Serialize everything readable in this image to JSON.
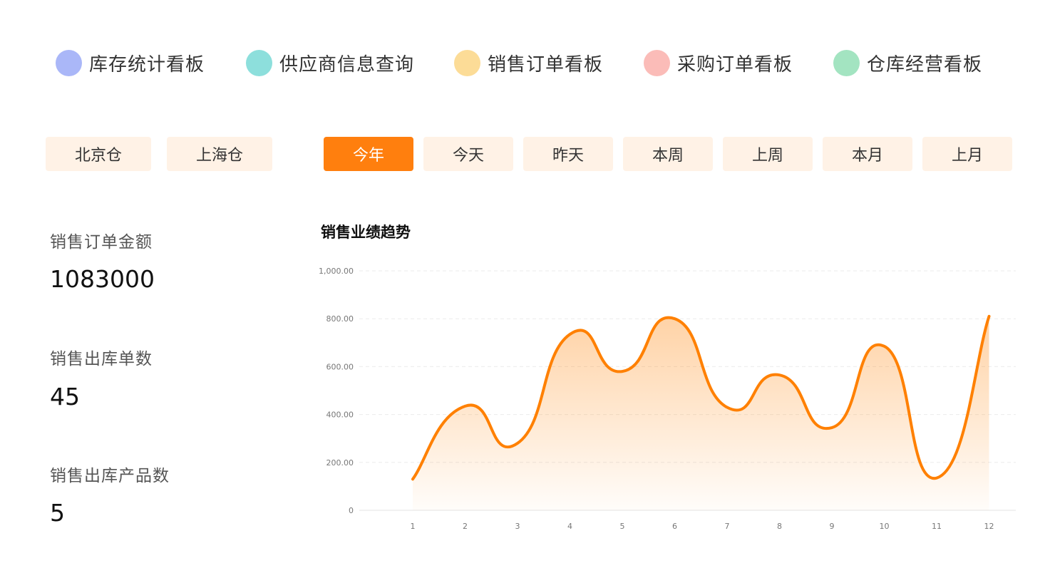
{
  "nav": {
    "items": [
      {
        "label": "库存统计看板",
        "color": "#aab7f8"
      },
      {
        "label": "供应商信息查询",
        "color": "#8ddfdc"
      },
      {
        "label": "销售订单看板",
        "color": "#fcdc97"
      },
      {
        "label": "采购订单看板",
        "color": "#fbbcb8"
      },
      {
        "label": "仓库经营看板",
        "color": "#a3e4c1"
      }
    ]
  },
  "warehouses": [
    "北京仓",
    "上海仓"
  ],
  "time_filters": {
    "items": [
      "今年",
      "今天",
      "昨天",
      "本周",
      "上周",
      "本月",
      "上月"
    ],
    "active": "今年"
  },
  "stats": [
    {
      "label": "销售订单金额",
      "value": "1083000"
    },
    {
      "label": "销售出库单数",
      "value": "45"
    },
    {
      "label": "销售出库产品数",
      "value": "5"
    }
  ],
  "chart_title": "销售业绩趋势",
  "chart_data": {
    "type": "area",
    "x": [
      "1",
      "2",
      "3",
      "4",
      "5",
      "6",
      "7",
      "8",
      "9",
      "10",
      "11",
      "12"
    ],
    "values": [
      130,
      435,
      280,
      735,
      580,
      800,
      430,
      565,
      345,
      685,
      135,
      810
    ],
    "ylim": [
      0,
      1000
    ],
    "yticks": [
      "0",
      "200.00",
      "400.00",
      "600.00",
      "800.00",
      "1,000.00"
    ],
    "grid": true,
    "line_color": "#ff8000",
    "smooth": true
  }
}
